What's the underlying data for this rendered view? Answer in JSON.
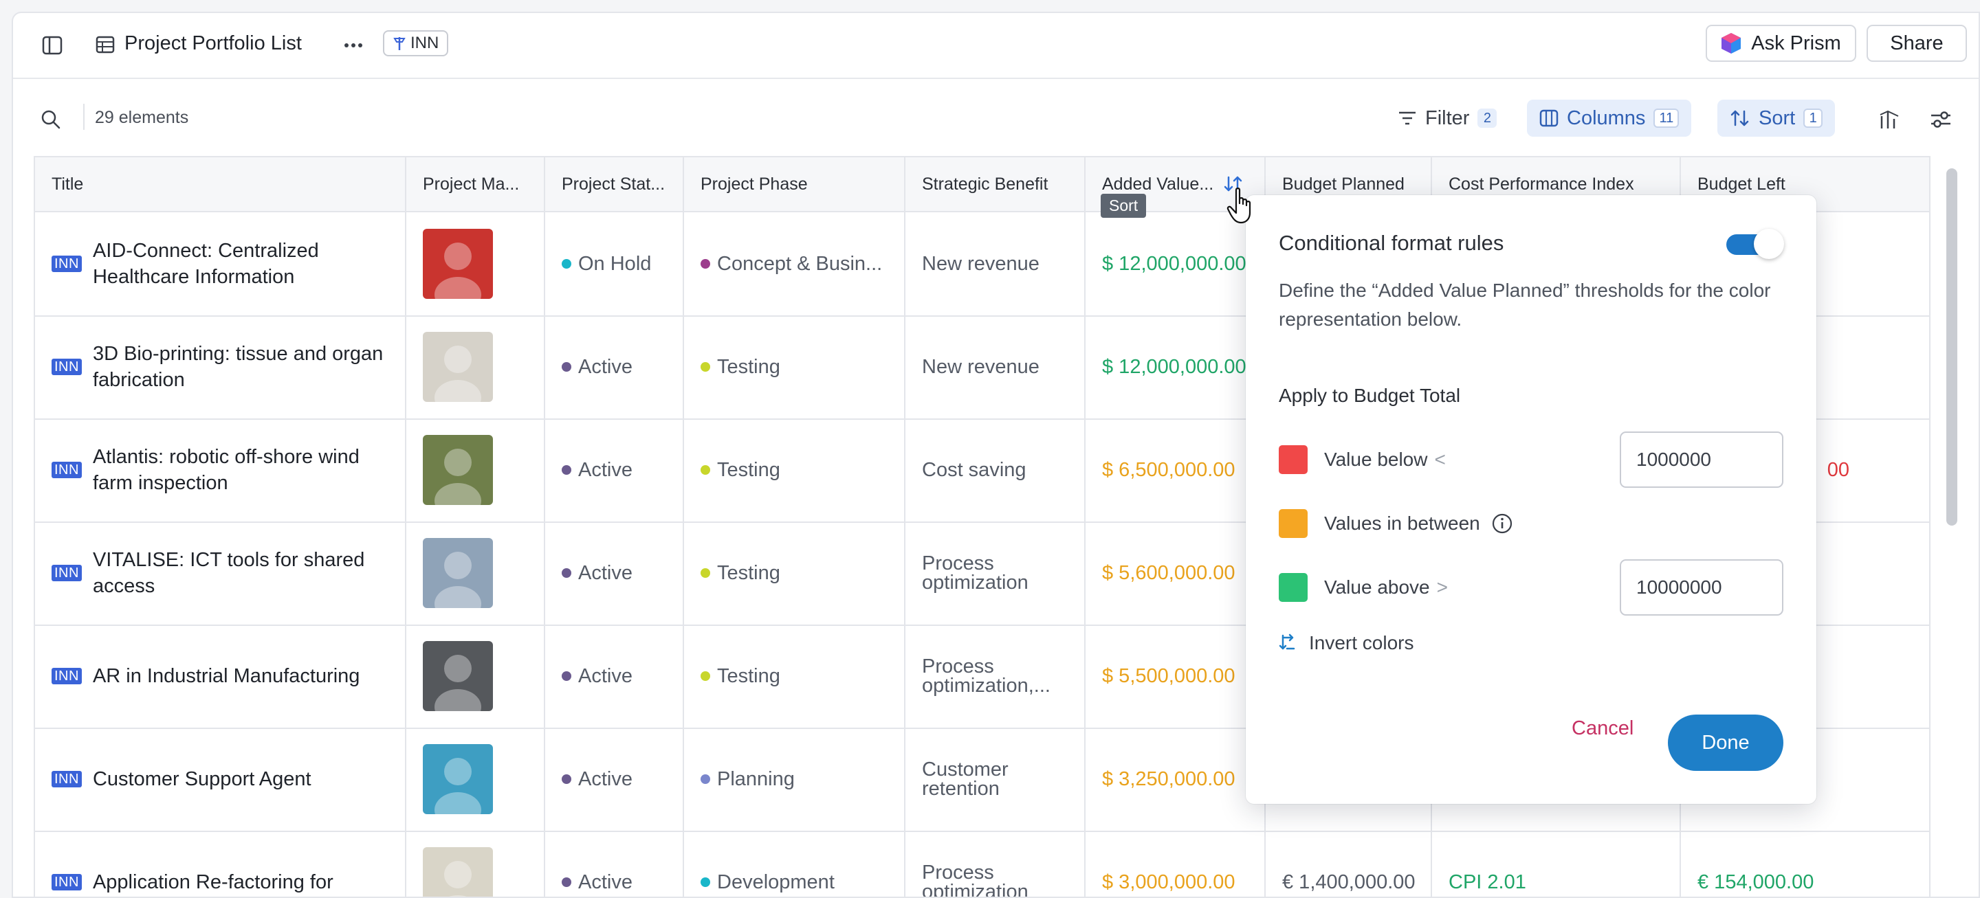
{
  "header": {
    "title": "Project Portfolio List",
    "tag_label": "INN",
    "ask_label": "Ask Prism",
    "share_label": "Share"
  },
  "toolbar": {
    "count": "29 elements",
    "filter_label": "Filter",
    "filter_count": "2",
    "columns_label": "Columns",
    "columns_count": "11",
    "sort_label": "Sort",
    "sort_count": "1"
  },
  "columns": [
    "Title",
    "Project Ma...",
    "Project Stat...",
    "Project Phase",
    "Strategic Benefit",
    "Added Value...",
    "Budget Planned",
    "Cost Performance Index",
    "Budget Left"
  ],
  "sort_tooltip": "Sort",
  "rows": [
    {
      "tag": "INN",
      "title": "AID-Connect: Centralized Healthcare Information",
      "status": "On Hold",
      "status_color": "#19b6c9",
      "phase": "Concept & Busin...",
      "phase_color": "#9c3d8c",
      "benefit": "New revenue",
      "added_value": "$ 12,000,000.00",
      "value_tone": "green",
      "avatar_bg": "#c9342f"
    },
    {
      "tag": "INN",
      "title": "3D Bio-printing: tissue and organ fabrication",
      "status": "Active",
      "status_color": "#6a5a8e",
      "phase": "Testing",
      "phase_color": "#c8d62b",
      "benefit": "New revenue",
      "added_value": "$ 12,000,000.00",
      "value_tone": "green",
      "avatar_bg": "#d6d2c9"
    },
    {
      "tag": "INN",
      "title": "Atlantis: robotic off-shore wind farm inspection",
      "status": "Active",
      "status_color": "#6a5a8e",
      "phase": "Testing",
      "phase_color": "#c8d62b",
      "benefit": "Cost saving",
      "added_value": "$ 6,500,000.00",
      "value_tone": "orange",
      "avatar_bg": "#6f7f4a",
      "budget_left": "00"
    },
    {
      "tag": "INN",
      "title": "VITALISE: ICT tools for shared access",
      "status": "Active",
      "status_color": "#6a5a8e",
      "phase": "Testing",
      "phase_color": "#c8d62b",
      "benefit": "Process optimization",
      "added_value": "$ 5,600,000.00",
      "value_tone": "orange",
      "avatar_bg": "#8fa3b8"
    },
    {
      "tag": "INN",
      "title": "AR in Industrial Manufacturing",
      "status": "Active",
      "status_color": "#6a5a8e",
      "phase": "Testing",
      "phase_color": "#c8d62b",
      "benefit": "Process optimization,...",
      "added_value": "$ 5,500,000.00",
      "value_tone": "orange",
      "avatar_bg": "#55585c"
    },
    {
      "tag": "INN",
      "title": "Customer Support Agent",
      "status": "Active",
      "status_color": "#6a5a8e",
      "phase": "Planning",
      "phase_color": "#7a86cc",
      "benefit": "Customer retention",
      "added_value": "$ 3,250,000.00",
      "value_tone": "orange",
      "avatar_bg": "#3e9ec2"
    },
    {
      "tag": "INN",
      "title": "Application Re-factoring for",
      "status": "Active",
      "status_color": "#6a5a8e",
      "phase": "Development",
      "phase_color": "#19b6c9",
      "benefit": "Process optimization",
      "added_value": "$ 3,000,000.00",
      "value_tone": "orange",
      "avatar_bg": "#d9d5c8",
      "budget_planned": "€ 1,400,000.00",
      "cpi": "CPI 2.01",
      "budget_left": "€ 154,000.00"
    }
  ],
  "popover": {
    "title": "Conditional format rules",
    "description": "Define the “Added Value Planned” thresholds for the color representation below.",
    "subtitle": "Apply to Budget Total",
    "rules": [
      {
        "label": "Value below",
        "comparator": "<",
        "value": "1000000",
        "color": "#f04848"
      },
      {
        "label": "Values in between",
        "comparator": "",
        "value": "",
        "color": "#f5a623"
      },
      {
        "label": "Value above",
        "comparator": ">",
        "value": "10000000",
        "color": "#2cc275"
      }
    ],
    "invert_label": "Invert colors",
    "cancel_label": "Cancel",
    "done_label": "Done",
    "toggle_on": true,
    "accent": "#1e7fc8"
  }
}
